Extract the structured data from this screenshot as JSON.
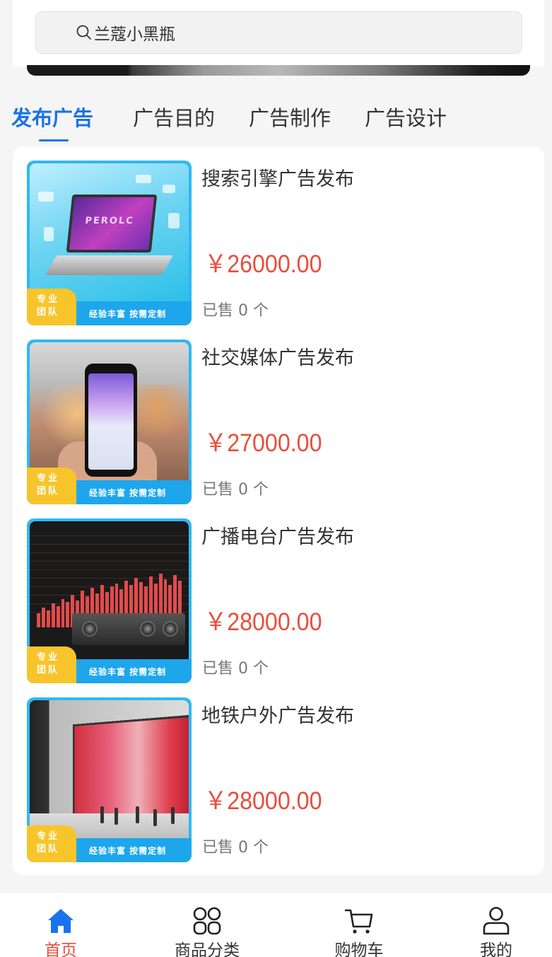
{
  "search": {
    "placeholder": "兰蔻小黑瓶"
  },
  "tabs": [
    {
      "label": "发布广告",
      "active": true
    },
    {
      "label": "广告目的",
      "active": false
    },
    {
      "label": "广告制作",
      "active": false
    },
    {
      "label": "广告设计",
      "active": false
    }
  ],
  "thumb_common": {
    "badge_line1": "专业",
    "badge_line2": "团队",
    "footer": "经验丰富 按需定制"
  },
  "products": [
    {
      "title": "搜索引擎广告发布",
      "price": "￥26000.00",
      "sold": "已售 0 个",
      "screen_text": "PEROLC"
    },
    {
      "title": "社交媒体广告发布",
      "price": "￥27000.00",
      "sold": "已售 0 个"
    },
    {
      "title": "广播电台广告发布",
      "price": "￥28000.00",
      "sold": "已售 0 个"
    },
    {
      "title": "地铁户外广告发布",
      "price": "￥28000.00",
      "sold": "已售 0 个"
    }
  ],
  "tabbar": [
    {
      "label": "首页",
      "icon": "home-icon",
      "active": true
    },
    {
      "label": "商品分类",
      "icon": "grid-icon",
      "active": false
    },
    {
      "label": "购物车",
      "icon": "cart-icon",
      "active": false
    },
    {
      "label": "我的",
      "icon": "user-icon",
      "active": false
    }
  ],
  "colors": {
    "accent_blue": "#1a73e8",
    "price_red": "#e94e3c",
    "tab_active": "#e94e3c"
  }
}
